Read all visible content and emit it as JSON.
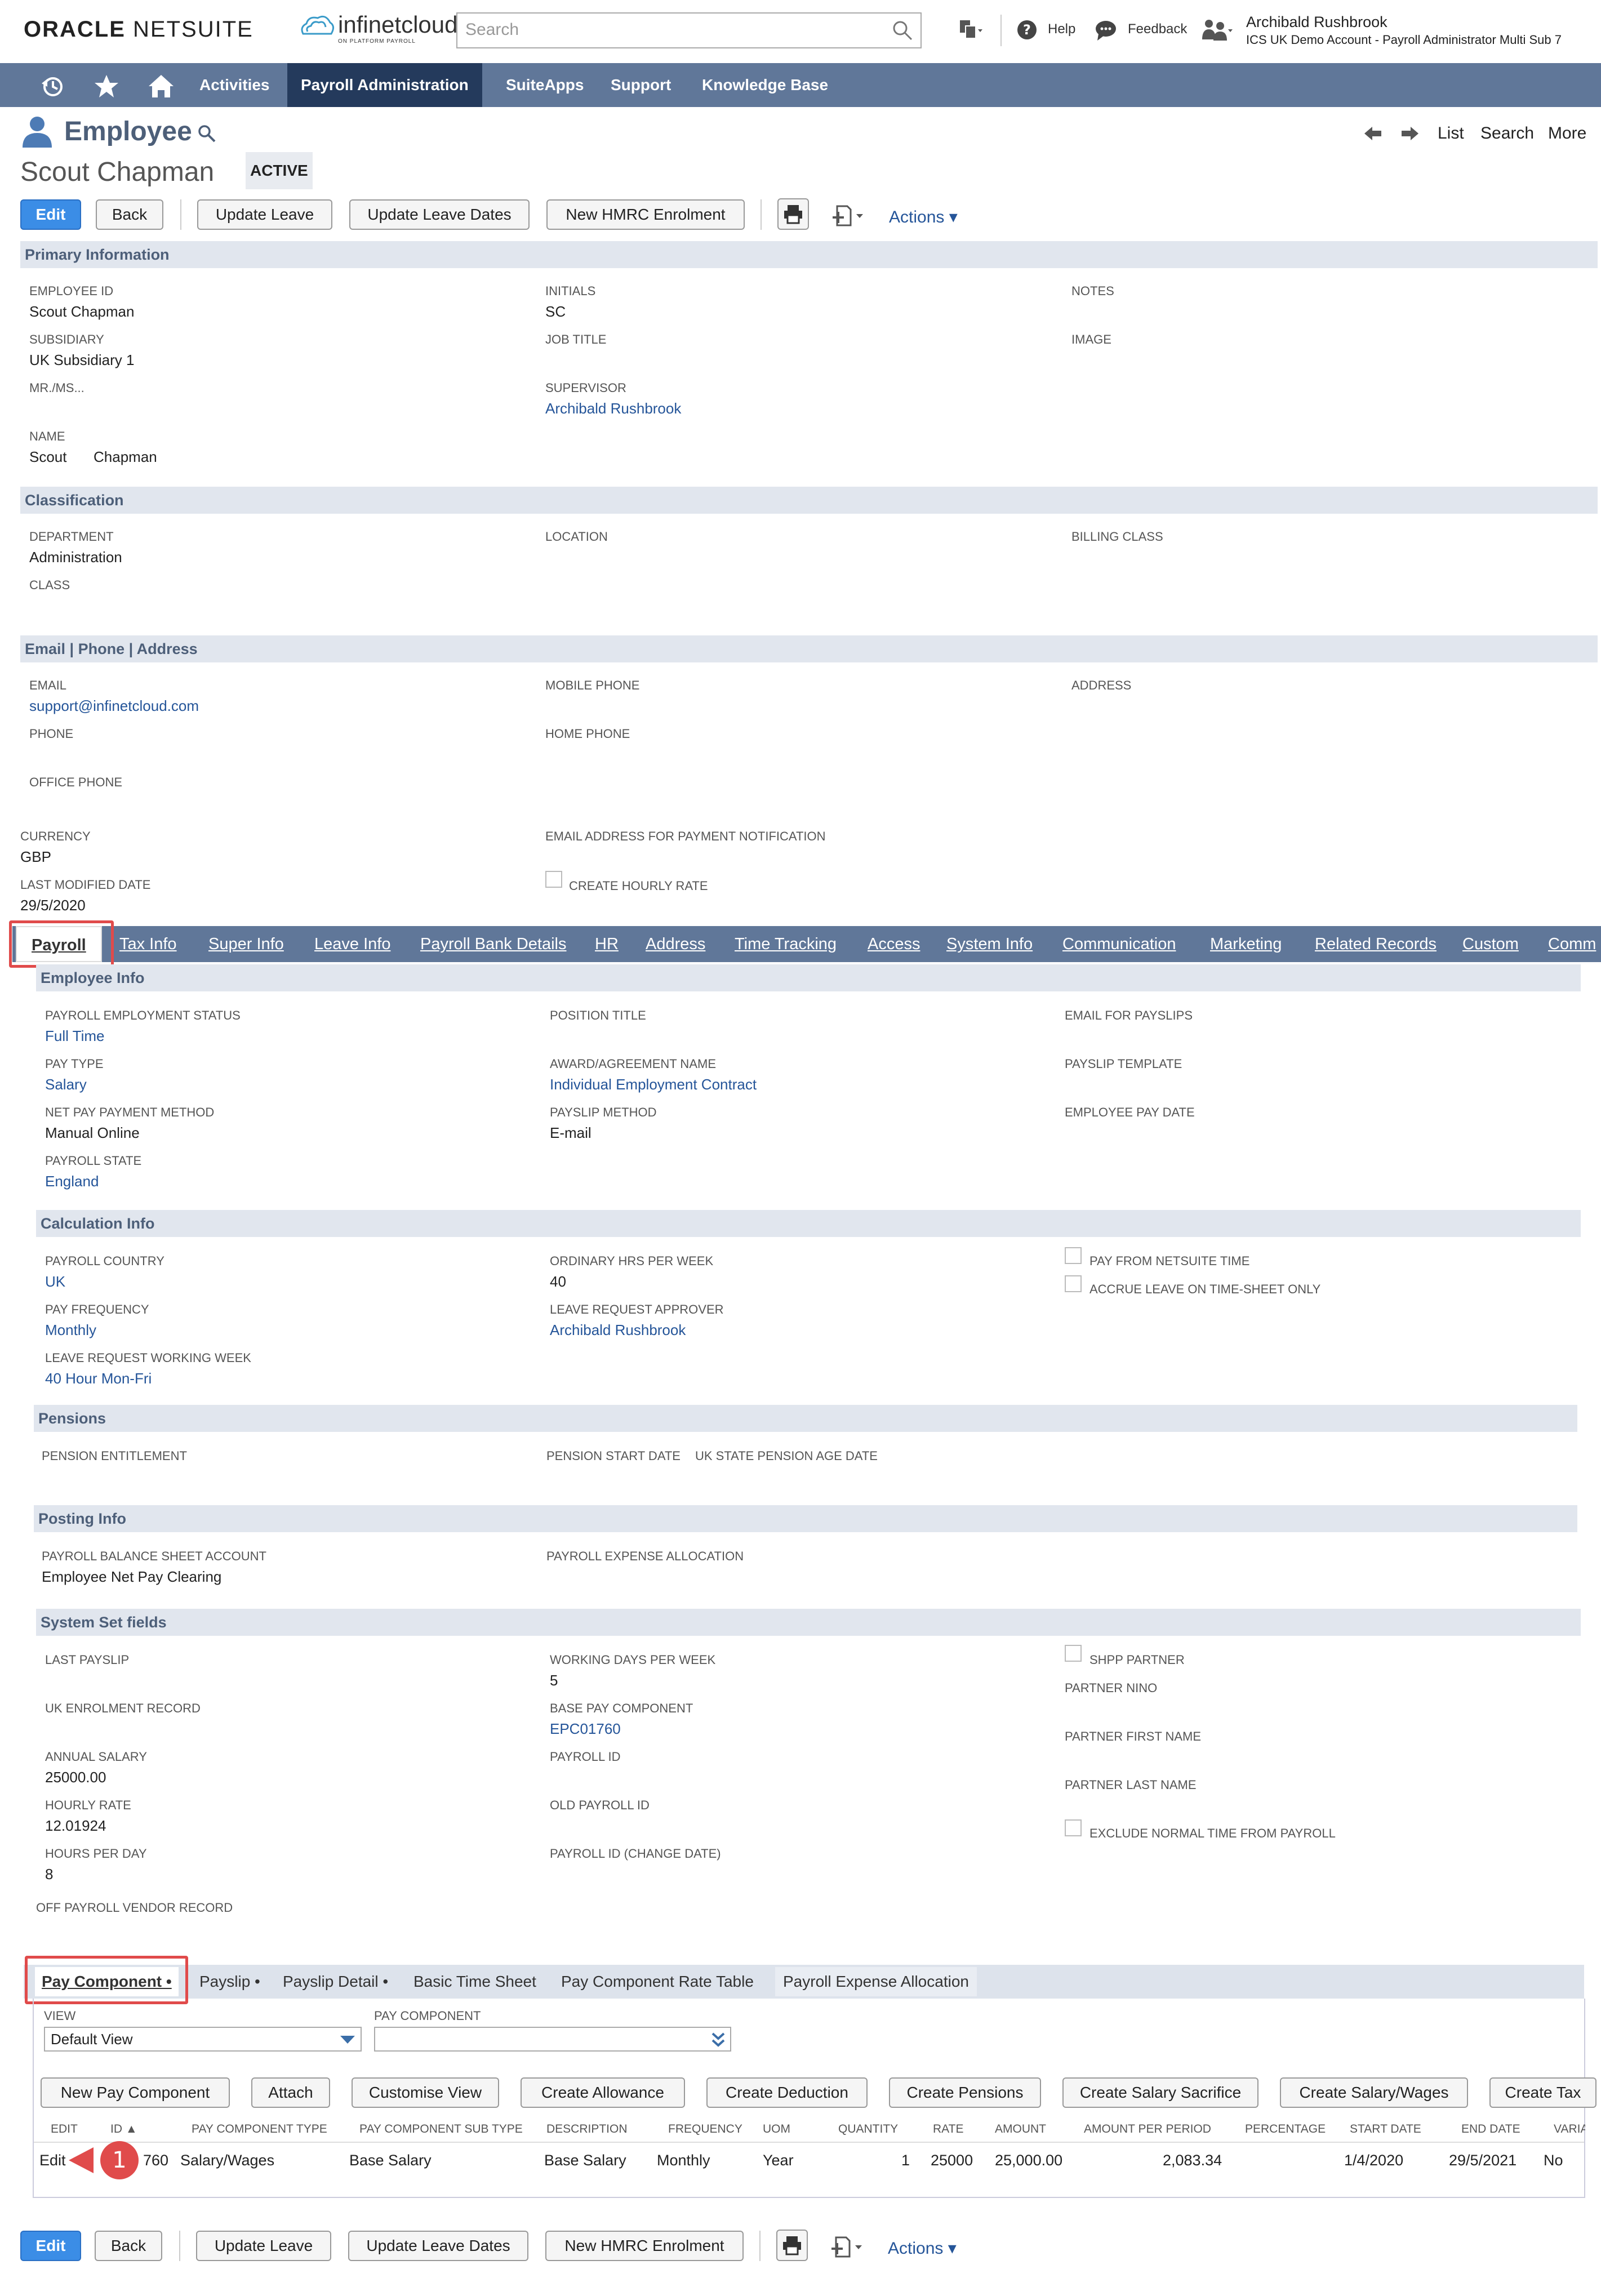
{
  "header": {
    "logo_oracle": "ORACLE",
    "logo_netsuite": "NETSUITE",
    "brand_name": "infinetcloud",
    "brand_tagline": "ON PLATFORM PAYROLL",
    "search_placeholder": "Search",
    "help": "Help",
    "feedback": "Feedback",
    "user_name": "Archibald Rushbrook",
    "user_role": "ICS UK Demo Account - Payroll Administrator Multi Sub 7"
  },
  "nav": {
    "items": [
      "Activities",
      "Payroll Administration",
      "SuiteApps",
      "Support",
      "Knowledge Base"
    ],
    "selected": "Payroll Administration"
  },
  "page": {
    "type": "Employee",
    "record_name": "Scout Chapman",
    "status": "ACTIVE",
    "right_nav": [
      "List",
      "Search",
      "More"
    ]
  },
  "buttons": {
    "edit": "Edit",
    "back": "Back",
    "update_leave": "Update Leave",
    "update_leave_dates": "Update Leave Dates",
    "new_hmrc": "New HMRC Enrolment",
    "actions": "Actions"
  },
  "primary": {
    "title": "Primary Information",
    "employee_id_label": "EMPLOYEE ID",
    "employee_id": "Scout Chapman",
    "initials_label": "INITIALS",
    "initials": "SC",
    "notes_label": "NOTES",
    "subsidiary_label": "SUBSIDIARY",
    "subsidiary": "UK Subsidiary 1",
    "job_title_label": "JOB TITLE",
    "image_label": "IMAGE",
    "mrms_label": "MR./MS...",
    "supervisor_label": "SUPERVISOR",
    "supervisor": "Archibald Rushbrook",
    "name_label": "NAME",
    "first_name": "Scout",
    "last_name": "Chapman"
  },
  "classification": {
    "title": "Classification",
    "department_label": "DEPARTMENT",
    "department": "Administration",
    "location_label": "LOCATION",
    "billing_class_label": "BILLING CLASS",
    "class_label": "CLASS"
  },
  "contact": {
    "title": "Email | Phone | Address",
    "email_label": "EMAIL",
    "email": "support@infinetcloud.com",
    "mobile_label": "MOBILE PHONE",
    "address_label": "ADDRESS",
    "phone_label": "PHONE",
    "home_phone_label": "HOME PHONE",
    "office_phone_label": "OFFICE PHONE"
  },
  "misc": {
    "currency_label": "CURRENCY",
    "currency": "GBP",
    "email_payment_label": "EMAIL ADDRESS FOR PAYMENT NOTIFICATION",
    "last_modified_label": "LAST MODIFIED DATE",
    "last_modified": "29/5/2020",
    "create_hourly_label": "CREATE HOURLY RATE"
  },
  "tabs": {
    "items": [
      "Payroll",
      "Tax Info",
      "Super Info",
      "Leave Info",
      "Payroll Bank Details",
      "HR",
      "Address",
      "Time Tracking",
      "Access",
      "System Info",
      "Communication",
      "Marketing",
      "Related Records",
      "Custom",
      "Comm"
    ],
    "selected": "Payroll"
  },
  "employee_info": {
    "title": "Employee Info",
    "status_label": "PAYROLL EMPLOYMENT STATUS",
    "status": "Full Time",
    "position_label": "POSITION TITLE",
    "email_payslips_label": "EMAIL FOR PAYSLIPS",
    "pay_type_label": "PAY TYPE",
    "pay_type": "Salary",
    "award_label": "AWARD/AGREEMENT NAME",
    "award": "Individual Employment Contract",
    "payslip_template_label": "PAYSLIP TEMPLATE",
    "net_pay_label": "NET PAY PAYMENT METHOD",
    "net_pay": "Manual Online",
    "payslip_method_label": "PAYSLIP METHOD",
    "payslip_method": "E-mail",
    "pay_date_label": "EMPLOYEE PAY DATE",
    "state_label": "PAYROLL STATE",
    "state": "England"
  },
  "calc_info": {
    "title": "Calculation Info",
    "country_label": "PAYROLL COUNTRY",
    "country": "UK",
    "ord_hrs_label": "ORDINARY HRS PER WEEK",
    "ord_hrs": "40",
    "pay_from_ns_label": "PAY FROM NETSUITE TIME",
    "accrue_label": "ACCRUE LEAVE ON TIME-SHEET ONLY",
    "frequency_label": "PAY FREQUENCY",
    "frequency": "Monthly",
    "approver_label": "LEAVE REQUEST APPROVER",
    "approver": "Archibald Rushbrook",
    "working_week_label": "LEAVE REQUEST WORKING WEEK",
    "working_week": "40 Hour Mon-Fri"
  },
  "pensions": {
    "title": "Pensions",
    "entitlement_label": "PENSION ENTITLEMENT",
    "start_label": "PENSION START DATE",
    "uk_state_label": "UK STATE PENSION AGE DATE"
  },
  "posting": {
    "title": "Posting Info",
    "balance_label": "PAYROLL BALANCE SHEET ACCOUNT",
    "balance": "Employee Net Pay Clearing",
    "expense_label": "PAYROLL EXPENSE ALLOCATION"
  },
  "system_set": {
    "title": "System Set fields",
    "last_payslip_label": "LAST PAYSLIP",
    "working_days_label": "WORKING DAYS PER WEEK",
    "working_days": "5",
    "shpp_label": "SHPP PARTNER",
    "partner_nino_label": "PARTNER NINO",
    "uk_enrol_label": "UK ENROLMENT RECORD",
    "base_pay_label": "BASE PAY COMPONENT",
    "base_pay": "EPC01760",
    "partner_first_label": "PARTNER FIRST NAME",
    "annual_label": "ANNUAL SALARY",
    "annual": "25000.00",
    "payroll_id_label": "PAYROLL ID",
    "partner_last_label": "PARTNER LAST NAME",
    "hourly_label": "HOURLY RATE",
    "hourly": "12.01924",
    "old_payroll_label": "OLD PAYROLL ID",
    "exclude_label": "EXCLUDE NORMAL TIME FROM PAYROLL",
    "hours_day_label": "HOURS PER DAY",
    "hours_day": "8",
    "payroll_change_label": "PAYROLL ID (CHANGE DATE)",
    "off_payroll_label": "OFF PAYROLL VENDOR RECORD"
  },
  "subtabs": {
    "items": [
      "Pay Component •",
      "Payslip •",
      "Payslip Detail •",
      "Basic Time Sheet",
      "Pay Component Rate Table",
      "Payroll Expense Allocation"
    ],
    "selected": "Pay Component •"
  },
  "filters": {
    "view_label": "VIEW",
    "view_value": "Default View",
    "pay_component_label": "PAY COMPONENT"
  },
  "sub_buttons": [
    "New Pay Component",
    "Attach",
    "Customise View",
    "Create Allowance",
    "Create Deduction",
    "Create Pensions",
    "Create Salary Sacrifice",
    "Create Salary/Wages",
    "Create Tax"
  ],
  "table": {
    "columns": [
      "EDIT",
      "ID ▲",
      "PAY COMPONENT TYPE",
      "PAY COMPONENT SUB TYPE",
      "DESCRIPTION",
      "FREQUENCY",
      "UOM",
      "QUANTITY",
      "RATE",
      "AMOUNT",
      "AMOUNT PER PERIOD",
      "PERCENTAGE",
      "START DATE",
      "END DATE",
      "VARIA"
    ],
    "rows": [
      [
        "Edit",
        "760",
        "Salary/Wages",
        "Base Salary",
        "Base Salary",
        "Monthly",
        "Year",
        "1",
        "25000",
        "25,000.00",
        "2,083.34",
        "",
        "1/4/2020",
        "29/5/2021",
        "No"
      ]
    ]
  },
  "callout_number": "1",
  "colors": {
    "nav": "#607799",
    "nav_selected": "#243a5c",
    "primary_button": "#3b8de6",
    "section": "#e1e6ee",
    "highlight": "#e04b4b"
  }
}
